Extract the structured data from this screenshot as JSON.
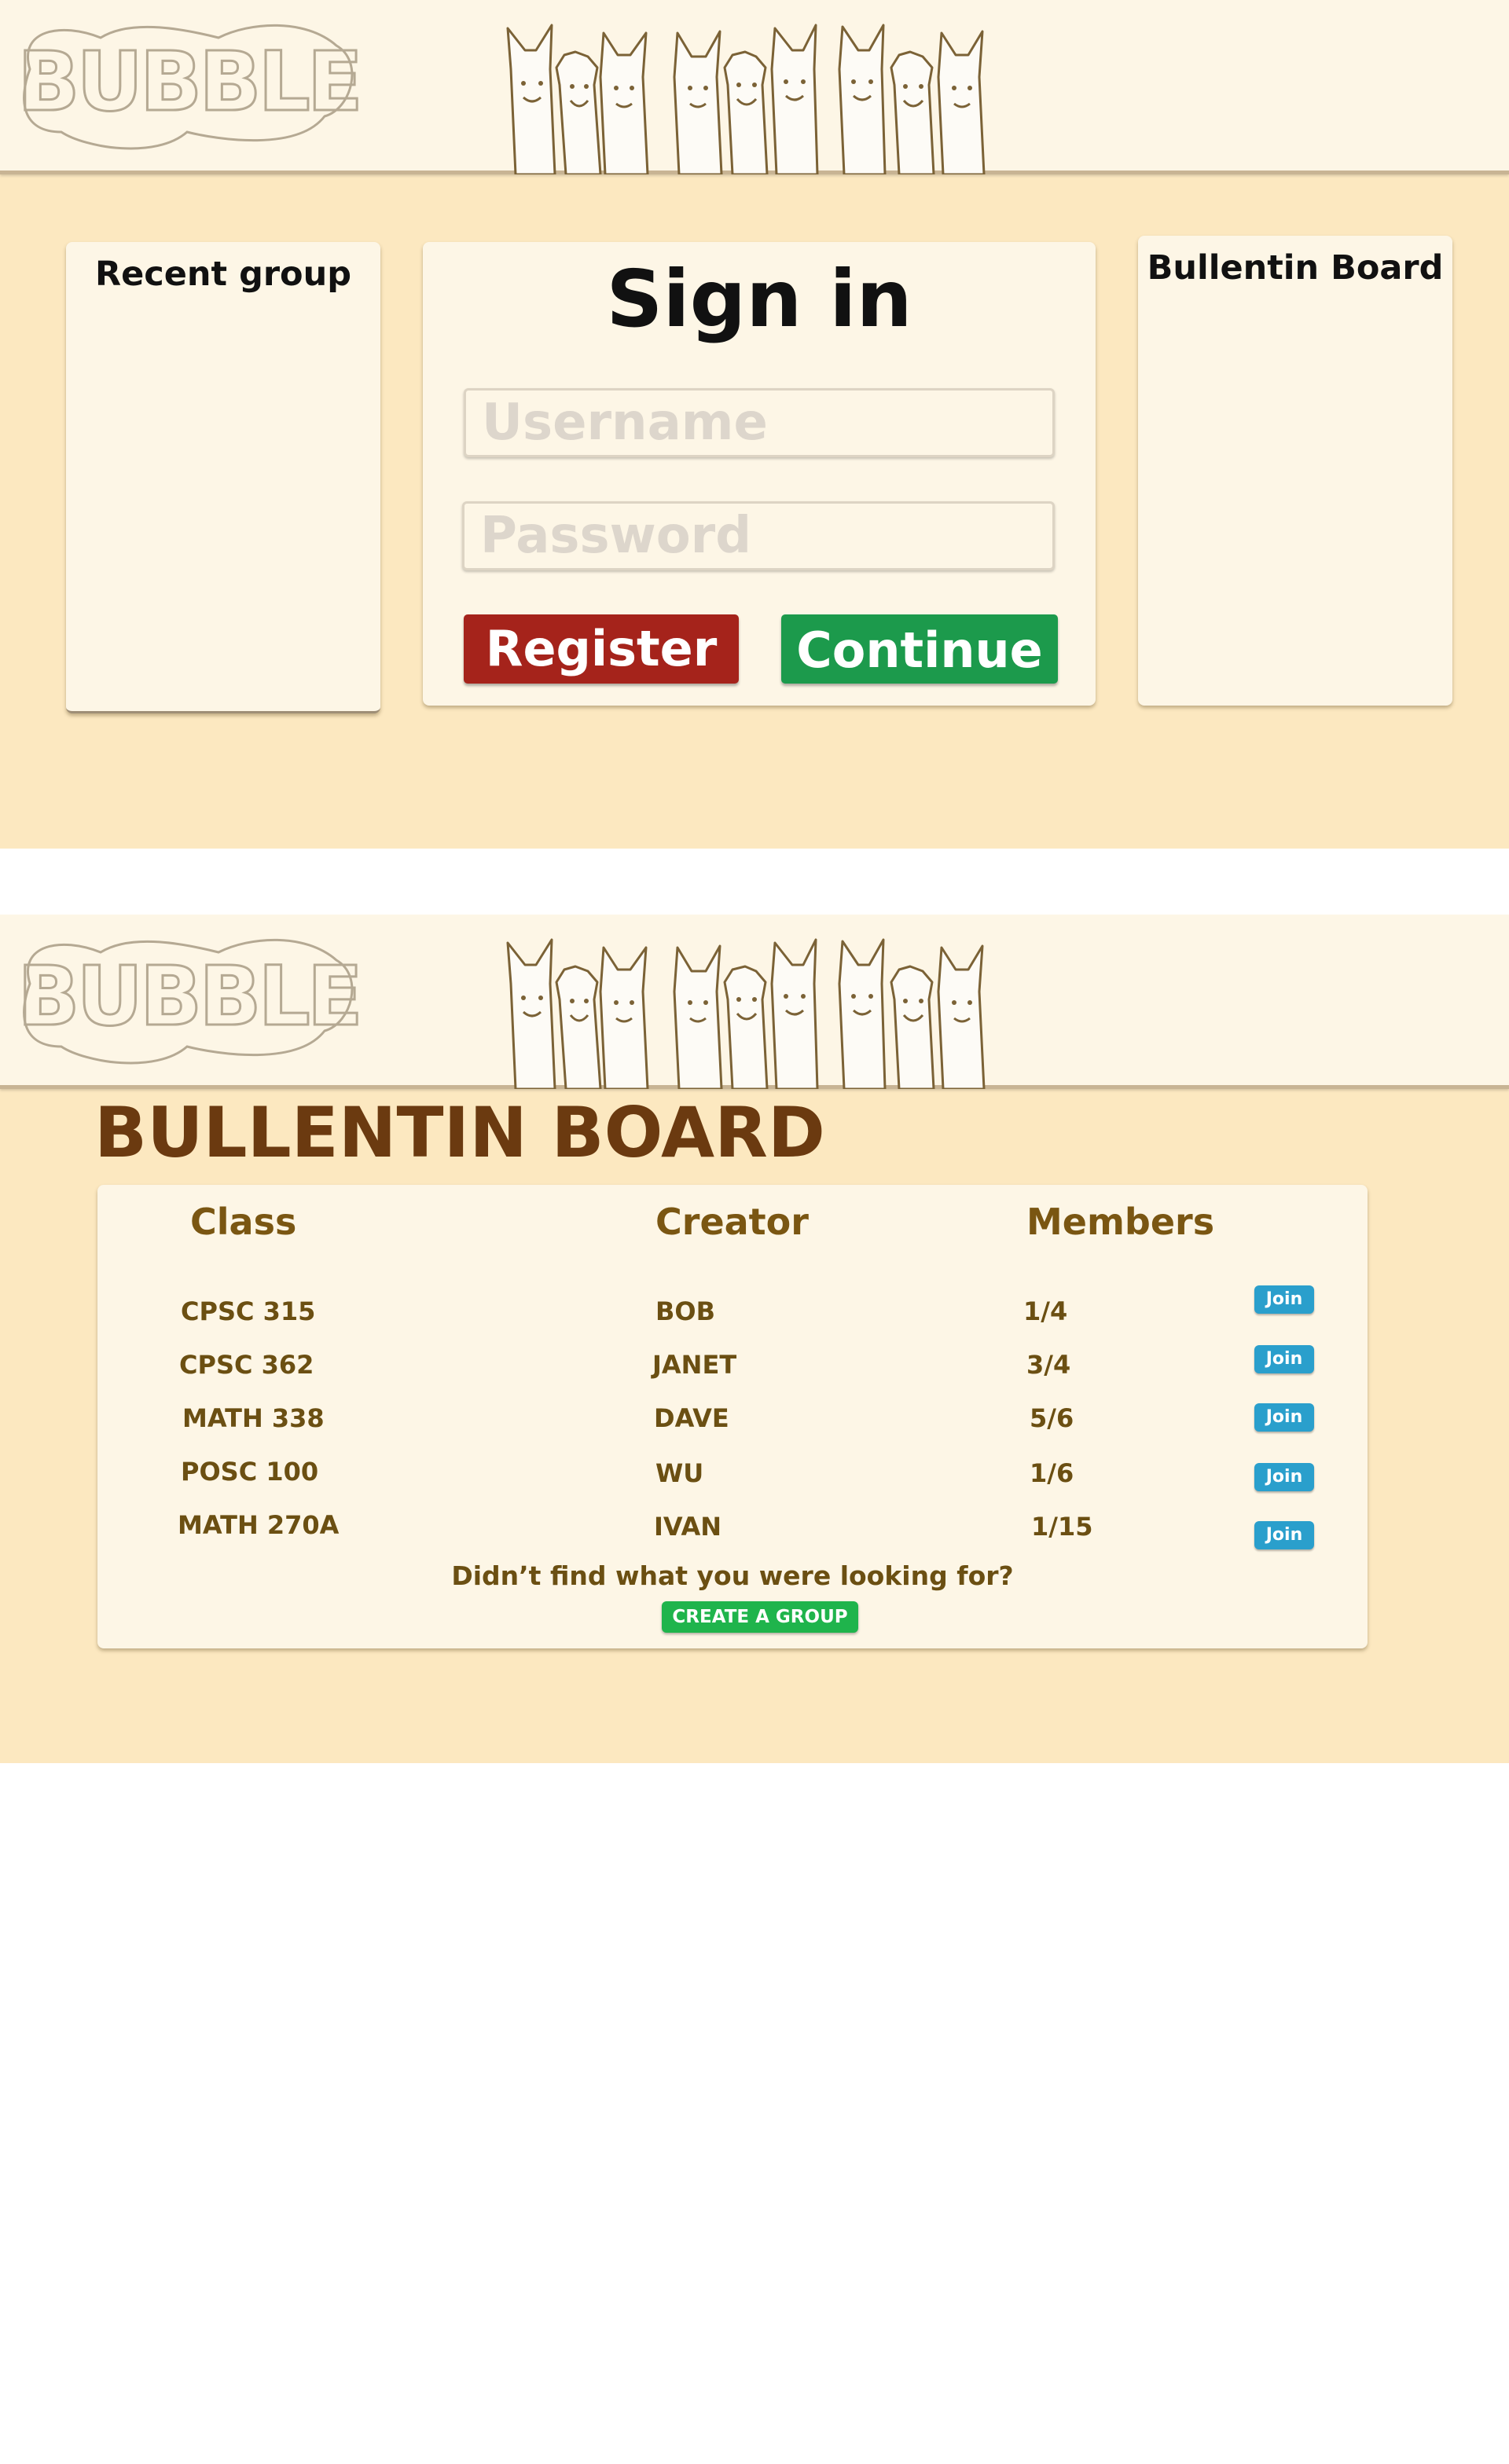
{
  "logo": {
    "text": "BUBBLE"
  },
  "colors": {
    "page_background": "#fce8c0",
    "header_background": "#fdf6e6",
    "panel_background": "#fdf6e6",
    "register": "#a5231b",
    "continue": "#1c9a4c",
    "join": "#2a9fcc",
    "create_group": "#1fb44c",
    "heading_brown": "#6b3a10",
    "table_text": "#6b4f12"
  },
  "signin_screen": {
    "recent_group_title": "Recent group",
    "signin_title": "Sign in",
    "username_placeholder": "Username",
    "password_placeholder": "Password",
    "register_label": "Register",
    "continue_label": "Continue",
    "bulletin_title": "Bullentin Board"
  },
  "board_screen": {
    "heading": "BULLENTIN BOARD",
    "columns": {
      "class": "Class",
      "creator": "Creator",
      "members": "Members"
    },
    "rows": [
      {
        "class": "CPSC 315",
        "creator": "BOB",
        "members": "1/4",
        "join_label": "Join"
      },
      {
        "class": "CPSC 362",
        "creator": "JANET",
        "members": "3/4",
        "join_label": "Join"
      },
      {
        "class": "MATH 338",
        "creator": "DAVE",
        "members": "5/6",
        "join_label": "Join"
      },
      {
        "class": "POSC 100",
        "creator": "WU",
        "members": "1/6",
        "join_label": "Join"
      },
      {
        "class": "MATH 270A",
        "creator": "IVAN",
        "members": "1/15",
        "join_label": "Join"
      }
    ],
    "not_found_text": "Didn’t find what you were looking for?",
    "create_group_label": "CREATE A GROUP"
  }
}
